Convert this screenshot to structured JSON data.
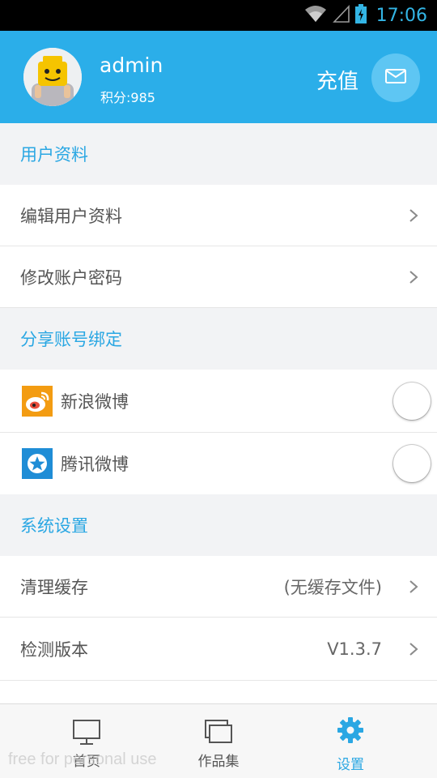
{
  "status_bar": {
    "time": "17:06",
    "time_color": "#33b5e5"
  },
  "header": {
    "username": "admin",
    "points": "积分:985",
    "recharge_label": "充值",
    "background": "#2baee9"
  },
  "sections": {
    "profile": {
      "title": "用户资料",
      "items": [
        {
          "label": "编辑用户资料"
        },
        {
          "label": "修改账户密码"
        }
      ]
    },
    "binding": {
      "title": "分享账号绑定",
      "items": [
        {
          "label": "新浪微博",
          "icon": "weibo-icon",
          "enabled": false
        },
        {
          "label": "腾讯微博",
          "icon": "tencent-weibo-icon",
          "enabled": false
        }
      ]
    },
    "system": {
      "title": "系统设置",
      "items": [
        {
          "label": "清理缓存",
          "value": "(无缓存文件)"
        },
        {
          "label": "检测版本",
          "value": "V1.3.7"
        }
      ]
    }
  },
  "bottom_nav": {
    "items": [
      {
        "label": "首页",
        "icon": "monitor-icon",
        "active": false
      },
      {
        "label": "作品集",
        "icon": "gallery-icon",
        "active": false
      },
      {
        "label": "设置",
        "icon": "gear-icon",
        "active": true
      }
    ],
    "active_color": "#2aa7e3"
  },
  "watermark": "free for personal use"
}
